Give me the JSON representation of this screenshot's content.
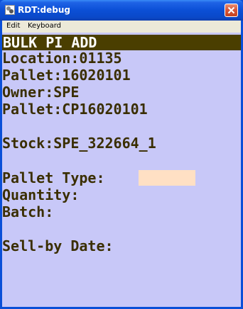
{
  "window": {
    "title": "RDT:debug",
    "colors": {
      "titlebar": "#0a4fd8",
      "close": "#d8573a",
      "client_bg": "#c8c8f8",
      "header_bg": "#4a3e00",
      "text": "#3a2e00",
      "input_bg": "#ffe0c4"
    }
  },
  "menu": {
    "items": [
      {
        "label": "Edit"
      },
      {
        "label": "Keyboard"
      }
    ]
  },
  "screen": {
    "header": "BULK PI ADD",
    "location": "Location:01135",
    "pallet1": "Pallet:16020101",
    "owner": "Owner:SPE",
    "pallet2": "Pallet:CP16020101",
    "stock": "Stock:SPE_322664_1",
    "pallet_type_label": "Pallet Type:",
    "pallet_type_value": "",
    "quantity_label": "Quantity:",
    "batch_label": "Batch:",
    "sellby_label": "Sell-by Date:"
  }
}
